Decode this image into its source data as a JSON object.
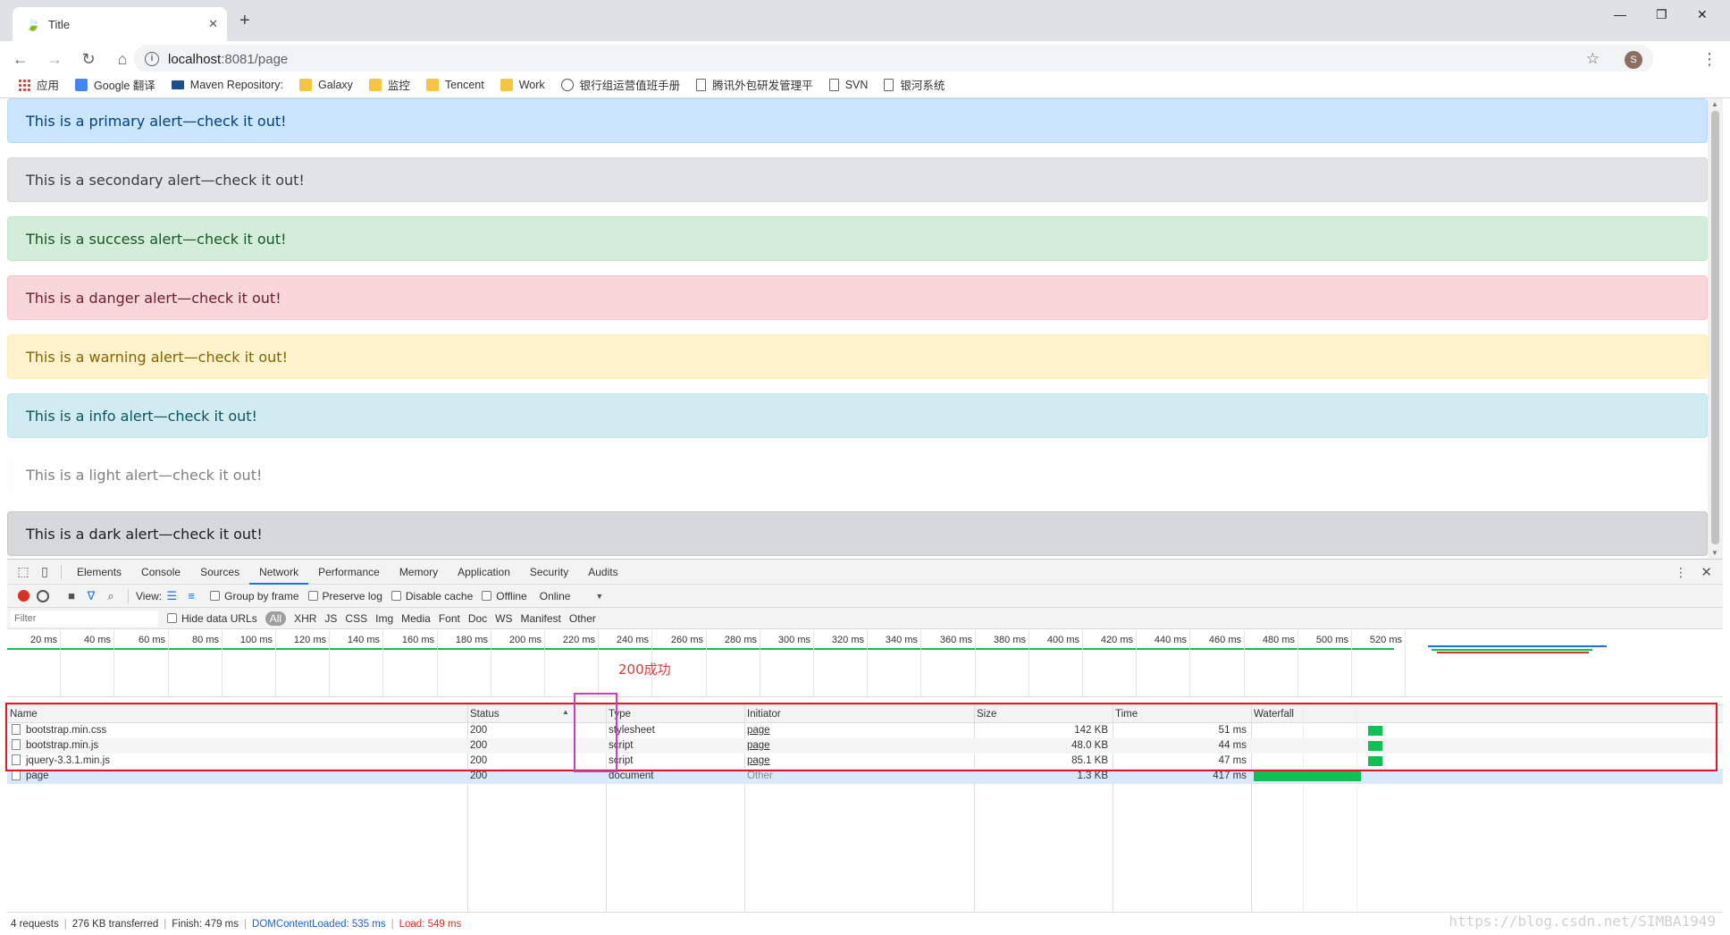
{
  "tab": {
    "title": "Title",
    "favicon": "leaf-icon"
  },
  "address": {
    "host": "localhost",
    "path": ":8081/page",
    "avatar_initial": "S"
  },
  "bookmarks": [
    {
      "label": "应用",
      "icon": "apps"
    },
    {
      "label": "Google 翻译",
      "icon": "gtr"
    },
    {
      "label": "Maven Repository:",
      "icon": "mvn"
    },
    {
      "label": "Galaxy",
      "icon": "folder"
    },
    {
      "label": "监控",
      "icon": "folder"
    },
    {
      "label": "Tencent",
      "icon": "folder"
    },
    {
      "label": "Work",
      "icon": "folder"
    },
    {
      "label": "银行组运营值班手册",
      "icon": "globe"
    },
    {
      "label": "腾讯外包研发管理平",
      "icon": "page"
    },
    {
      "label": "SVN",
      "icon": "page"
    },
    {
      "label": "银河系统",
      "icon": "page"
    }
  ],
  "alerts": [
    {
      "text": "This is a primary alert—check it out!",
      "bg": "#cce5ff",
      "fg": "#004085",
      "border": "#b8daff"
    },
    {
      "text": "This is a secondary alert—check it out!",
      "bg": "#e2e3e5",
      "fg": "#383d41",
      "border": "#d6d8db"
    },
    {
      "text": "This is a success alert—check it out!",
      "bg": "#d4edda",
      "fg": "#155724",
      "border": "#c3e6cb"
    },
    {
      "text": "This is a danger alert—check it out!",
      "bg": "#f8d7da",
      "fg": "#721c24",
      "border": "#f5c6cb"
    },
    {
      "text": "This is a warning alert—check it out!",
      "bg": "#fff3cd",
      "fg": "#856404",
      "border": "#ffeeba"
    },
    {
      "text": "This is a info alert—check it out!",
      "bg": "#d1ecf1",
      "fg": "#0c5460",
      "border": "#bee5eb"
    },
    {
      "text": "This is a light alert—check it out!",
      "bg": "#fefefe",
      "fg": "#818182",
      "border": "#fdfdfe"
    },
    {
      "text": "This is a dark alert—check it out!",
      "bg": "#d6d8d9",
      "fg": "#1b1e21",
      "border": "#c6c8ca"
    }
  ],
  "devtools": {
    "tabs": [
      "Elements",
      "Console",
      "Sources",
      "Network",
      "Performance",
      "Memory",
      "Application",
      "Security",
      "Audits"
    ],
    "active_tab": "Network",
    "toolbar": {
      "view_label": "View:",
      "group_by_frame": "Group by frame",
      "preserve_log": "Preserve log",
      "disable_cache": "Disable cache",
      "offline": "Offline",
      "throttle": "Online"
    },
    "filter": {
      "placeholder": "Filter",
      "hide_data_urls": "Hide data URLs",
      "types": [
        "All",
        "XHR",
        "JS",
        "CSS",
        "Img",
        "Media",
        "Font",
        "Doc",
        "WS",
        "Manifest",
        "Other"
      ]
    },
    "timeline_ticks": [
      "20 ms",
      "40 ms",
      "60 ms",
      "80 ms",
      "100 ms",
      "120 ms",
      "140 ms",
      "160 ms",
      "180 ms",
      "200 ms",
      "220 ms",
      "240 ms",
      "260 ms",
      "280 ms",
      "300 ms",
      "320 ms",
      "340 ms",
      "360 ms",
      "380 ms",
      "400 ms",
      "420 ms",
      "440 ms",
      "460 ms",
      "480 ms",
      "500 ms",
      "520 ms"
    ],
    "annotation": "200成功",
    "columns": [
      "Name",
      "Status",
      "Type",
      "Initiator",
      "Size",
      "Time",
      "Waterfall"
    ],
    "rows": [
      {
        "name": "bootstrap.min.css",
        "status": "200",
        "type": "stylesheet",
        "initiator": "page",
        "size": "142 KB",
        "time": "51 ms",
        "waterfall_ms": 51
      },
      {
        "name": "bootstrap.min.js",
        "status": "200",
        "type": "script",
        "initiator": "page",
        "size": "48.0 KB",
        "time": "44 ms",
        "waterfall_ms": 44
      },
      {
        "name": "jquery-3.3.1.min.js",
        "status": "200",
        "type": "script",
        "initiator": "page",
        "size": "85.1 KB",
        "time": "47 ms",
        "waterfall_ms": 47
      },
      {
        "name": "page",
        "status": "200",
        "type": "document",
        "initiator": "Other",
        "size": "1.3 KB",
        "time": "417 ms",
        "waterfall_ms": 417
      }
    ],
    "status_bar": {
      "requests": "4 requests",
      "transferred": "276 KB transferred",
      "finish": "Finish: 479 ms",
      "dom_loaded": "DOMContentLoaded: 535 ms",
      "load": "Load: 549 ms"
    }
  },
  "watermark": "https://blog.csdn.net/SIMBA1949"
}
